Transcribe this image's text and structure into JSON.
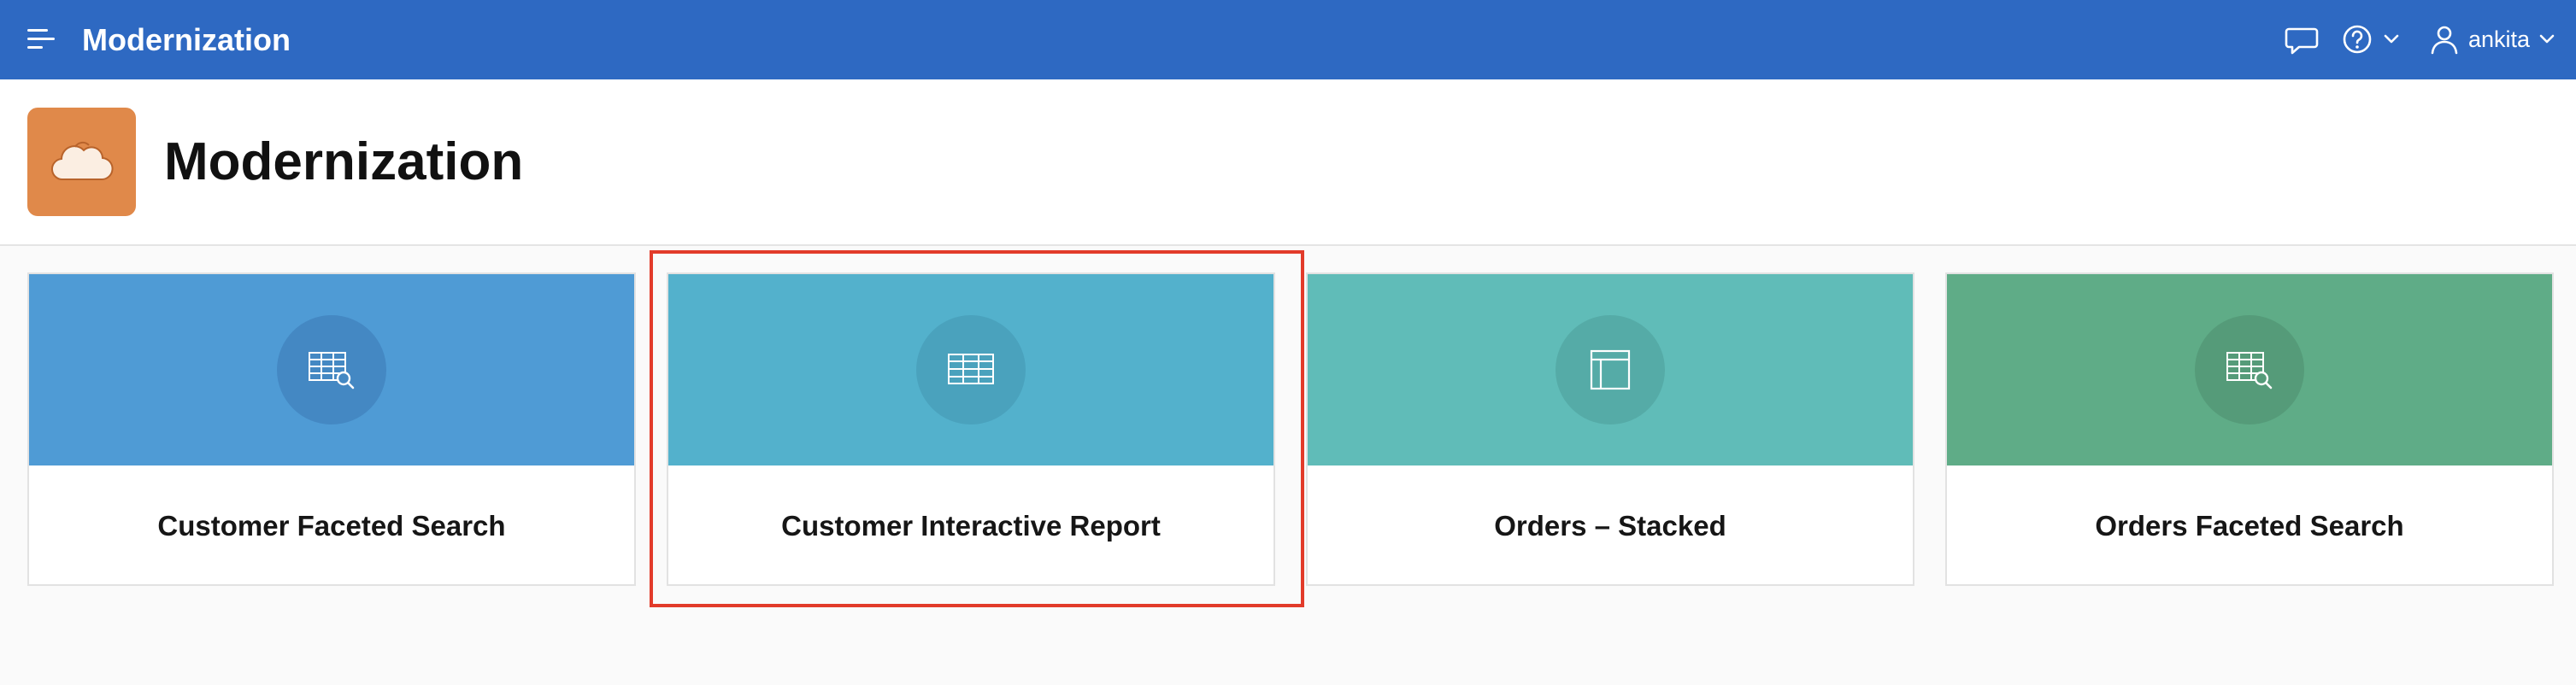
{
  "header": {
    "app_name": "Modernization",
    "user": "ankita",
    "icons": [
      "menu-icon",
      "chat-icon",
      "help-icon",
      "chevron-down-icon",
      "user-icon"
    ],
    "bar_color": "#2e69c2"
  },
  "title_region": {
    "title": "Modernization",
    "logo_icon": "cloud-icon",
    "logo_color": "#e0894a"
  },
  "cards": [
    {
      "title": "Customer Faceted Search",
      "icon": "table-search-icon",
      "color": "#4f9bd5"
    },
    {
      "title": "Customer Interactive Report",
      "icon": "table-icon",
      "color": "#53b1cc",
      "highlighted": true
    },
    {
      "title": "Orders – Stacked",
      "icon": "layout-icon",
      "color": "#60bcb8"
    },
    {
      "title": "Orders Faceted Search",
      "icon": "table-search-icon",
      "color": "#5fac87"
    }
  ],
  "highlight_color": "#e23b2a"
}
